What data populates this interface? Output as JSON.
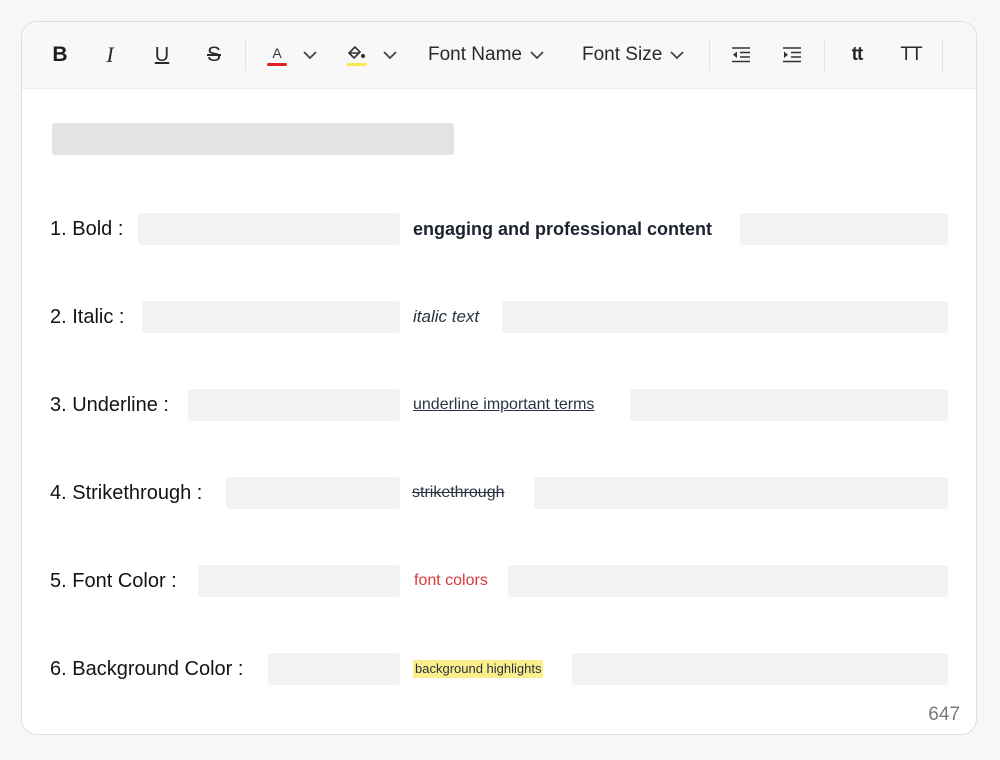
{
  "colors": {
    "font_color": "#e02020",
    "highlight": "#fde74c",
    "sample_red": "#d83a3a",
    "sample_highlight": "#fbef8c"
  },
  "toolbar": {
    "bold_label": "B",
    "italic_label": "I",
    "underline_label": "U",
    "strike_label": "S",
    "font_color_label": "A",
    "font_name_label": "Font Name",
    "font_size_label": "Font Size",
    "lowercase_label": "tt",
    "uppercase_label": "TT"
  },
  "items": [
    {
      "label": "1. Bold :",
      "sample": "engaging and professional content"
    },
    {
      "label": "2. Italic :",
      "sample": "italic text"
    },
    {
      "label": "3. Underline :",
      "sample": "underline important terms"
    },
    {
      "label": "4. Strikethrough :",
      "sample": "strikethrough"
    },
    {
      "label": "5. Font Color :",
      "sample": "font colors"
    },
    {
      "label": "6. Background Color :",
      "sample": "background highlights"
    }
  ],
  "character_count": "647"
}
